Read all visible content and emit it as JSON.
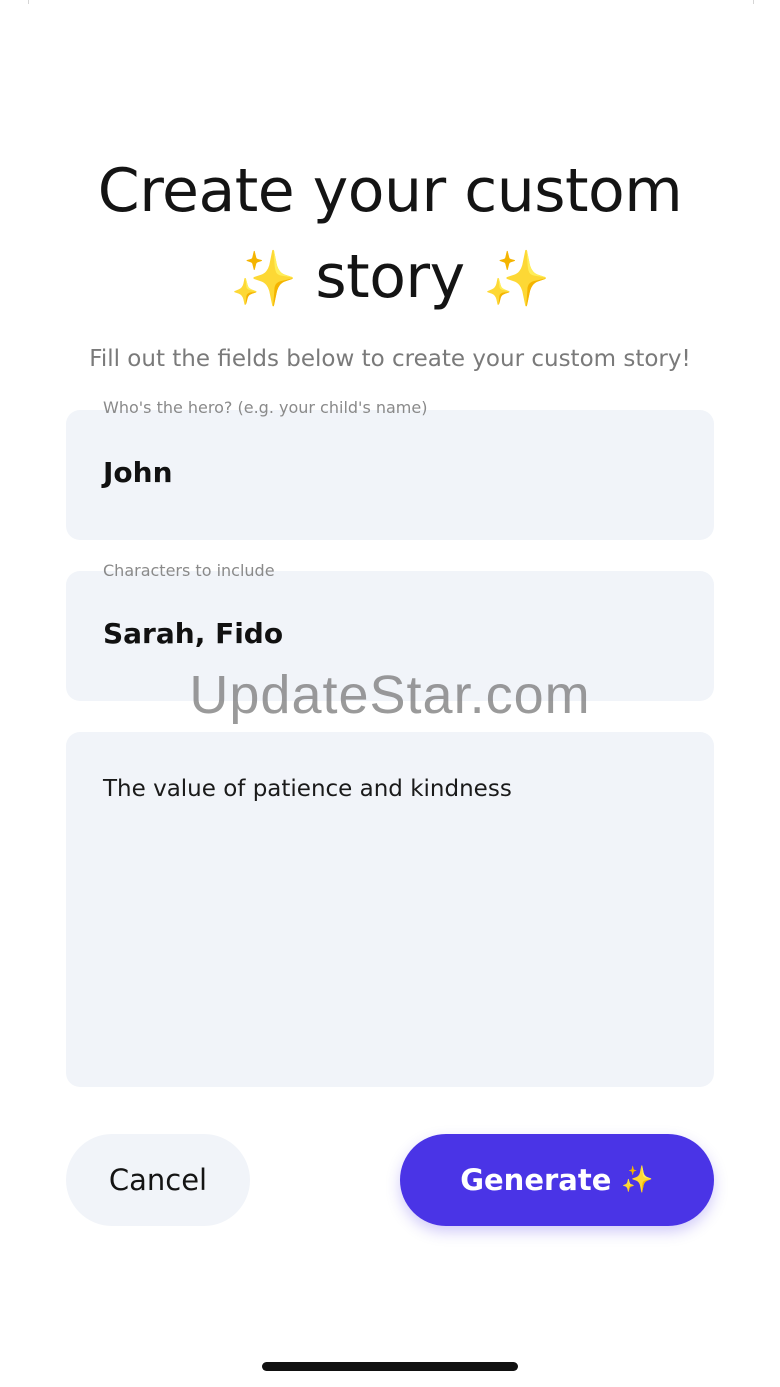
{
  "header": {
    "title_line1": "Create your custom",
    "title_word": "story",
    "sparkle_glyph": "✨",
    "subtitle": "Fill out the fields below to create your custom story!"
  },
  "form": {
    "hero": {
      "label": "Who's the hero? (e.g. your child's name)",
      "value": "John"
    },
    "characters": {
      "label": "Characters to include",
      "value": "Sarah, Fido"
    },
    "moral": {
      "value": "The value of patience and kindness"
    }
  },
  "actions": {
    "cancel_label": "Cancel",
    "generate_label": "Generate",
    "generate_icon": "sparkles-icon"
  },
  "watermark": "UpdateStar.com",
  "colors": {
    "accent": "#4a34e6",
    "field_bg": "#f1f4f9",
    "sparkle": "#f2c23a"
  }
}
